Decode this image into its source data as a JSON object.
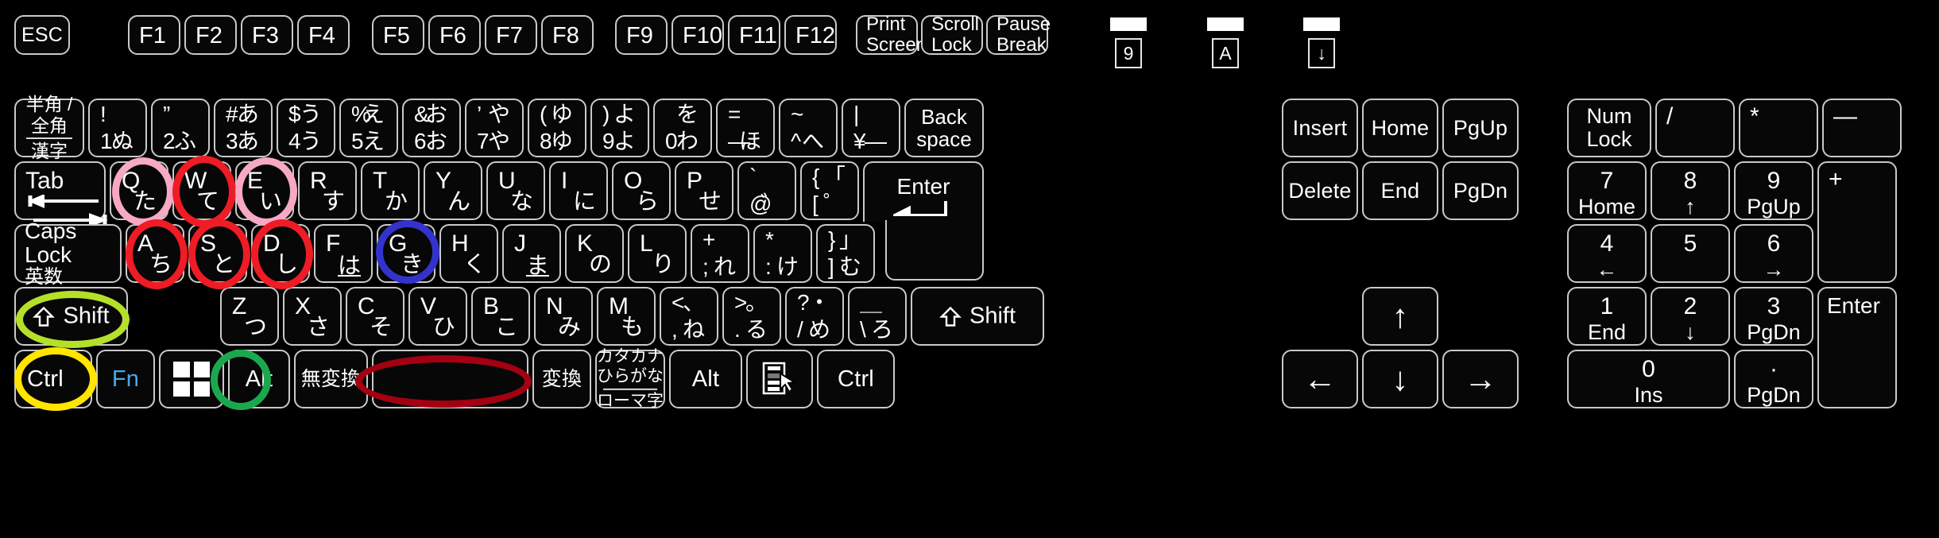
{
  "device": {
    "name": "Japanese 109-key keyboard layout diagram",
    "colors": {
      "background": "#000000",
      "key_fill": "#070707",
      "key_border": "#c9c9c9",
      "legend": "#ffffff",
      "fn_blue": "#4aa8e8"
    }
  },
  "indicators": [
    {
      "name": "num-lock-led",
      "symbol": "9"
    },
    {
      "name": "caps-lock-led",
      "symbol": "A"
    },
    {
      "name": "scroll-lock-led",
      "symbol": "↓"
    }
  ],
  "function_row": {
    "esc": "ESC",
    "f_keys": [
      "F1",
      "F2",
      "F3",
      "F4",
      "F5",
      "F6",
      "F7",
      "F8",
      "F9",
      "F10",
      "F11",
      "F12"
    ],
    "system": [
      {
        "l1": "Print",
        "l2": "Screen"
      },
      {
        "l1": "Scroll",
        "l2": "Lock"
      },
      {
        "l1": "Pause",
        "l2": "Break"
      }
    ]
  },
  "number_row": {
    "hankaku": {
      "l1": "半角 /",
      "l2": "全角",
      "l3": "漢字"
    },
    "keys": [
      {
        "tl": "!",
        "tr": "",
        "bl": "1",
        "br": "ぬ"
      },
      {
        "tl": "”",
        "tr": "",
        "bl": "2",
        "br": "ふ"
      },
      {
        "tl": "#",
        "tr": "あ",
        "bl": "3",
        "br": "あ"
      },
      {
        "tl": "$",
        "tr": "う",
        "bl": "4",
        "br": "う"
      },
      {
        "tl": "%",
        "tr": "え",
        "bl": "5",
        "br": "え"
      },
      {
        "tl": "&",
        "tr": "お",
        "bl": "6",
        "br": "お"
      },
      {
        "tl": "’",
        "tr": "や",
        "bl": "7",
        "br": "や"
      },
      {
        "tl": "(",
        "tr": "ゆ",
        "bl": "8",
        "br": "ゆ"
      },
      {
        "tl": ")",
        "tr": "よ",
        "bl": "9",
        "br": "よ"
      },
      {
        "tl": "",
        "tr": "を",
        "bl": "0",
        "br": "わ"
      },
      {
        "tl": "=",
        "tr": "",
        "bl": "—",
        "br": "ほ"
      },
      {
        "tl": "~",
        "tr": "",
        "bl": "^",
        "br": "へ"
      },
      {
        "tl": "|",
        "tr": "",
        "bl": "¥",
        "br": "—"
      }
    ],
    "backspace": {
      "l1": "Back",
      "l2": "space"
    }
  },
  "qwerty_row": {
    "tab": "Tab",
    "keys": [
      {
        "alpha": "Q",
        "kana": "た"
      },
      {
        "alpha": "W",
        "kana": "て"
      },
      {
        "alpha": "E",
        "kana": "い"
      },
      {
        "alpha": "R",
        "kana": "す"
      },
      {
        "alpha": "T",
        "kana": "か"
      },
      {
        "alpha": "Y",
        "kana": "ん"
      },
      {
        "alpha": "U",
        "kana": "な"
      },
      {
        "alpha": "I",
        "kana": "に"
      },
      {
        "alpha": "O",
        "kana": "ら"
      },
      {
        "alpha": "P",
        "kana": "せ"
      }
    ],
    "at_key": {
      "tl": "`",
      "bl": "@",
      "br": "゛"
    },
    "bracket_key": {
      "tl": "{",
      "tr": "「",
      "bl": "[",
      "br": "゜"
    },
    "enter": "Enter"
  },
  "home_row": {
    "caps": {
      "l1": "Caps Lock",
      "l2": "英数"
    },
    "keys": [
      {
        "alpha": "A",
        "kana": "ち"
      },
      {
        "alpha": "S",
        "kana": "と"
      },
      {
        "alpha": "D",
        "kana": "し"
      },
      {
        "alpha": "F",
        "kana": "は",
        "underline": true
      },
      {
        "alpha": "G",
        "kana": "き"
      },
      {
        "alpha": "H",
        "kana": "く"
      },
      {
        "alpha": "J",
        "kana": "ま",
        "underline": true
      },
      {
        "alpha": "K",
        "kana": "の"
      },
      {
        "alpha": "L",
        "kana": "り"
      }
    ],
    "semi_key": {
      "tl": "+",
      "bl": ";",
      "br": "れ"
    },
    "colon_key": {
      "tl": "*",
      "bl": ":",
      "br": "け"
    },
    "brace_key": {
      "tl": "}",
      "tr": "」",
      "bl": "]",
      "br": "む"
    }
  },
  "shift_row": {
    "left_shift": "Shift",
    "right_shift": "Shift",
    "keys": [
      {
        "alpha": "Z",
        "kana": "つ"
      },
      {
        "alpha": "X",
        "kana": "さ"
      },
      {
        "alpha": "C",
        "kana": "そ"
      },
      {
        "alpha": "V",
        "kana": "ひ"
      },
      {
        "alpha": "B",
        "kana": "こ"
      },
      {
        "alpha": "N",
        "kana": "み"
      },
      {
        "alpha": "M",
        "kana": "も"
      }
    ],
    "comma_key": {
      "tl": "<",
      "tr": "、",
      "bl": ",",
      "br": "ね"
    },
    "period_key": {
      "tl": ">",
      "tr": "。",
      "bl": ".",
      "br": "る"
    },
    "slash_key": {
      "tl": "?",
      "tr": "・",
      "bl": "/",
      "br": "め"
    },
    "ro_key": {
      "tl": "＿",
      "bl": "\\",
      "br": "ろ"
    }
  },
  "bottom_row": {
    "ctrl_left": "Ctrl",
    "fn": "Fn",
    "win": "windows-logo",
    "alt_left": "Alt",
    "muhenkan": "無変換",
    "space": "",
    "henkan": "変換",
    "katakana": {
      "l1": "カタカナ",
      "l2": "ひらがな",
      "l3": "ローマ字"
    },
    "alt_right": "Alt",
    "menu": "context-menu",
    "ctrl_right": "Ctrl"
  },
  "nav_cluster": {
    "row1": [
      "Insert",
      "Home",
      "PgUp"
    ],
    "row2": [
      "Delete",
      "End",
      "PgDn"
    ],
    "arrows": {
      "up": "↑",
      "left": "←",
      "down": "↓",
      "right": "→"
    }
  },
  "numpad": {
    "numlock": {
      "l1": "Num",
      "l2": "Lock"
    },
    "divide": "/",
    "multiply": "*",
    "minus": "—",
    "plus": "+",
    "enter": "Enter",
    "keys": [
      {
        "digit": "7",
        "fn": "Home"
      },
      {
        "digit": "8",
        "fn": "↑"
      },
      {
        "digit": "9",
        "fn": "PgUp"
      },
      {
        "digit": "4",
        "fn": "←"
      },
      {
        "digit": "5",
        "fn": ""
      },
      {
        "digit": "6",
        "fn": "→"
      },
      {
        "digit": "1",
        "fn": "End"
      },
      {
        "digit": "2",
        "fn": "↓"
      },
      {
        "digit": "3",
        "fn": "PgDn"
      },
      {
        "digit": "0",
        "fn": "Ins"
      },
      {
        "digit": "·",
        "fn": "PgDn"
      }
    ]
  },
  "annotations": [
    {
      "name": "annotation-q",
      "target": "Q",
      "color": "#f7a8c4",
      "shape": "ellipse"
    },
    {
      "name": "annotation-w",
      "target": "W",
      "color": "#ee1c25",
      "shape": "ellipse"
    },
    {
      "name": "annotation-e",
      "target": "E",
      "color": "#f7a8c4",
      "shape": "ellipse"
    },
    {
      "name": "annotation-a",
      "target": "A",
      "color": "#ee1c25",
      "shape": "ellipse"
    },
    {
      "name": "annotation-s",
      "target": "S",
      "color": "#ee1c25",
      "shape": "ellipse"
    },
    {
      "name": "annotation-d",
      "target": "D",
      "color": "#ee1c25",
      "shape": "ellipse"
    },
    {
      "name": "annotation-g",
      "target": "G",
      "color": "#3333cc",
      "shape": "circle"
    },
    {
      "name": "annotation-left-shift",
      "target": "Shift",
      "color": "#b4e02a",
      "shape": "ellipse"
    },
    {
      "name": "annotation-left-ctrl",
      "target": "Ctrl",
      "color": "#ffe500",
      "shape": "ellipse"
    },
    {
      "name": "annotation-left-alt",
      "target": "Alt",
      "color": "#1aa84f",
      "shape": "circle"
    },
    {
      "name": "annotation-space",
      "target": "Space",
      "color": "#a30012",
      "shape": "ellipse"
    }
  ]
}
